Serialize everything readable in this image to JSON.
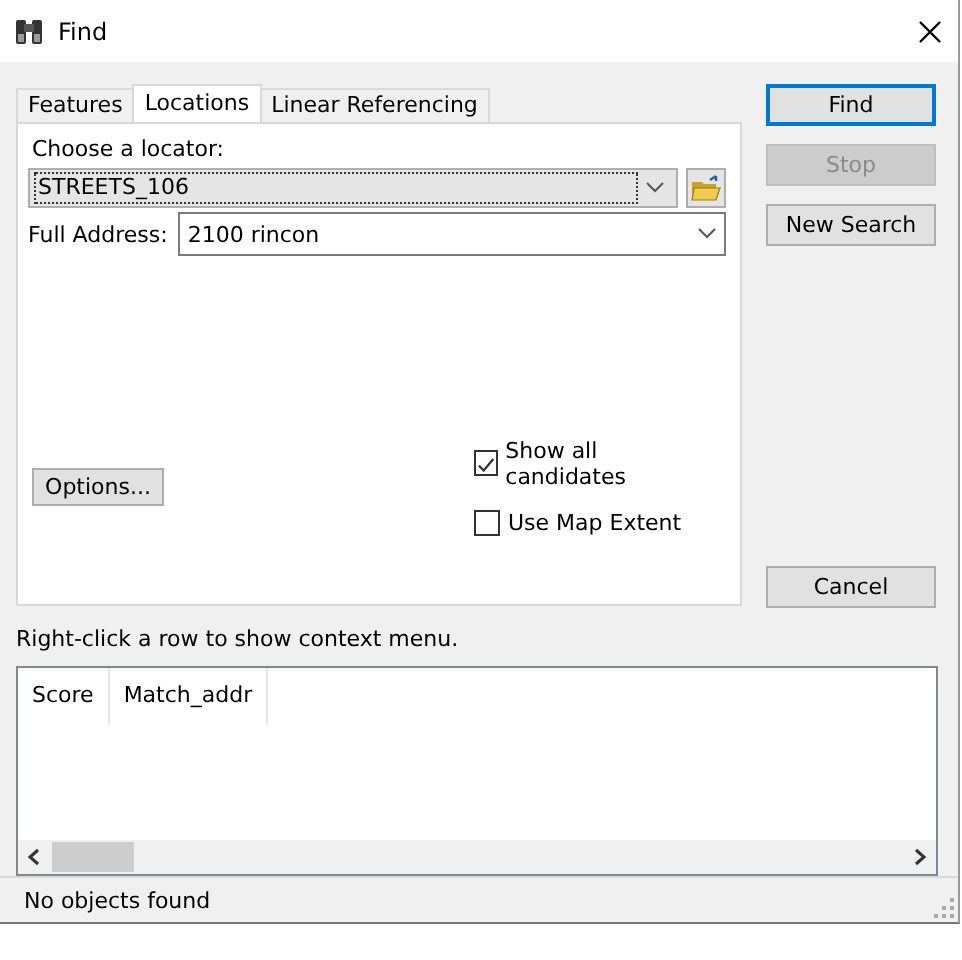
{
  "window": {
    "title": "Find"
  },
  "tabs": [
    {
      "label": "Features",
      "selected": false
    },
    {
      "label": "Locations",
      "selected": true
    },
    {
      "label": "Linear Referencing",
      "selected": false
    }
  ],
  "locator": {
    "label": "Choose a locator:",
    "value": "STREETS_106"
  },
  "address": {
    "label": "Full Address:",
    "value": "2100 rincon"
  },
  "options_button": {
    "label": "Options..."
  },
  "checkboxes": [
    {
      "label": "Show all candidates",
      "checked": true
    },
    {
      "label": "Use Map Extent",
      "checked": false
    }
  ],
  "buttons": [
    {
      "label": "Find",
      "default": true,
      "disabled": false
    },
    {
      "label": "Stop",
      "default": false,
      "disabled": true
    },
    {
      "label": "New Search",
      "default": false,
      "disabled": false
    }
  ],
  "cancel_button": {
    "label": "Cancel"
  },
  "hint": "Right-click a row to show context menu.",
  "results": {
    "columns": [
      "Score",
      "Match_addr"
    ]
  },
  "status_bar": "No objects found"
}
